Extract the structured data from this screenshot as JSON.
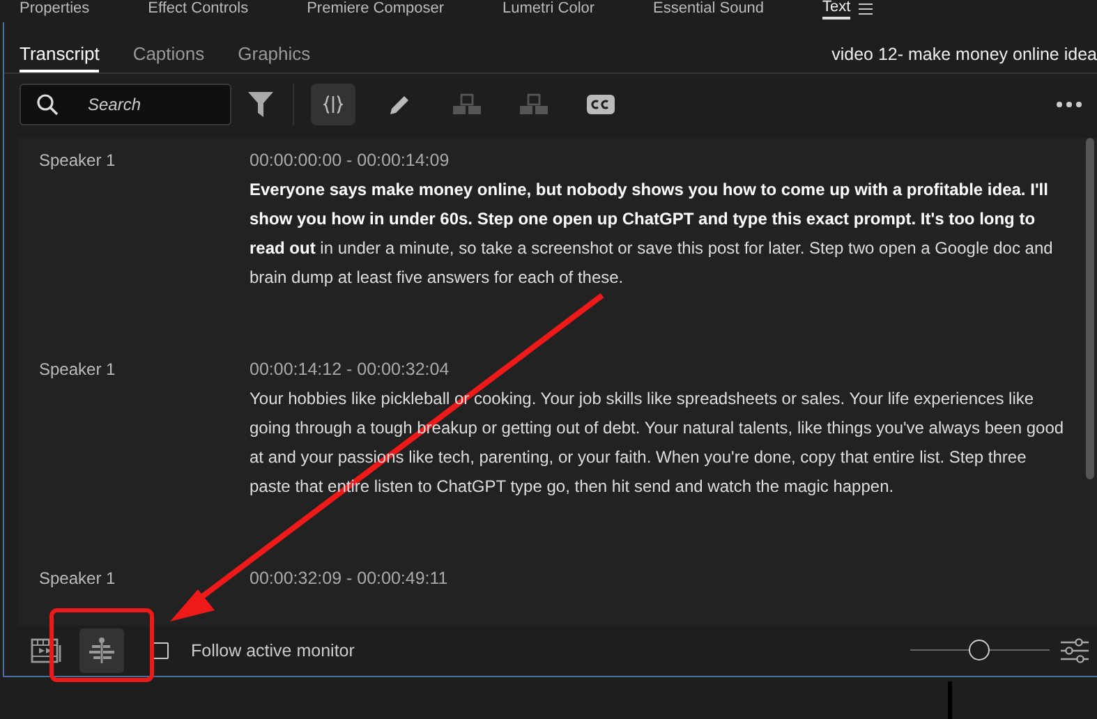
{
  "panel_tabs": [
    {
      "label": "Properties",
      "selected": false
    },
    {
      "label": "Effect Controls",
      "selected": false
    },
    {
      "label": "Premiere Composer",
      "selected": false
    },
    {
      "label": "Lumetri Color",
      "selected": false
    },
    {
      "label": "Essential Sound",
      "selected": false
    },
    {
      "label": "Text",
      "selected": true
    }
  ],
  "sub_tabs": [
    {
      "label": "Transcript",
      "selected": true
    },
    {
      "label": "Captions",
      "selected": false
    },
    {
      "label": "Graphics",
      "selected": false
    }
  ],
  "sequence_name": "video 12- make money online idea",
  "search": {
    "placeholder": "Search"
  },
  "toolbar": [
    {
      "kind": "split",
      "selected": true,
      "disabled": false
    },
    {
      "kind": "edit",
      "selected": false,
      "disabled": false
    },
    {
      "kind": "merge-up",
      "selected": false,
      "disabled": true
    },
    {
      "kind": "merge-down",
      "selected": false,
      "disabled": true
    },
    {
      "kind": "captions",
      "selected": false,
      "disabled": false
    }
  ],
  "segments": [
    {
      "speaker": "Speaker 1",
      "time": "00:00:00:00 - 00:00:14:09",
      "text": "**Everyone says make money online, but nobody shows you how to come up with a profitable idea. I'll show you how in under 60s. Step one open up ChatGPT and type this exact prompt. It's too long to read out** in under a minute, so take a screenshot or save this post for later. Step two open a Google doc and brain dump at least five answers for each of these."
    },
    {
      "speaker": "Speaker 1",
      "time": "00:00:14:12 - 00:00:32:04",
      "text": "Your hobbies like pickleball or cooking. Your job skills like spreadsheets or sales. Your life experiences like going through a tough breakup or getting out of debt. Your natural talents, like things you've always been good at and your passions like tech, parenting, or your faith. When you're done, copy that entire list. Step three paste that entire listen to ChatGPT type go, then hit send and watch the magic happen."
    },
    {
      "speaker": "Speaker 1",
      "time": "00:00:32:09 - 00:00:49:11"
    }
  ],
  "bottom_tools": [
    {
      "kind": "sequence",
      "selected": false
    },
    {
      "kind": "sync",
      "selected": true
    }
  ],
  "follow_monitor": {
    "label": "Follow active monitor",
    "checked": false
  },
  "zoom_slider": {
    "level": 0.5
  }
}
